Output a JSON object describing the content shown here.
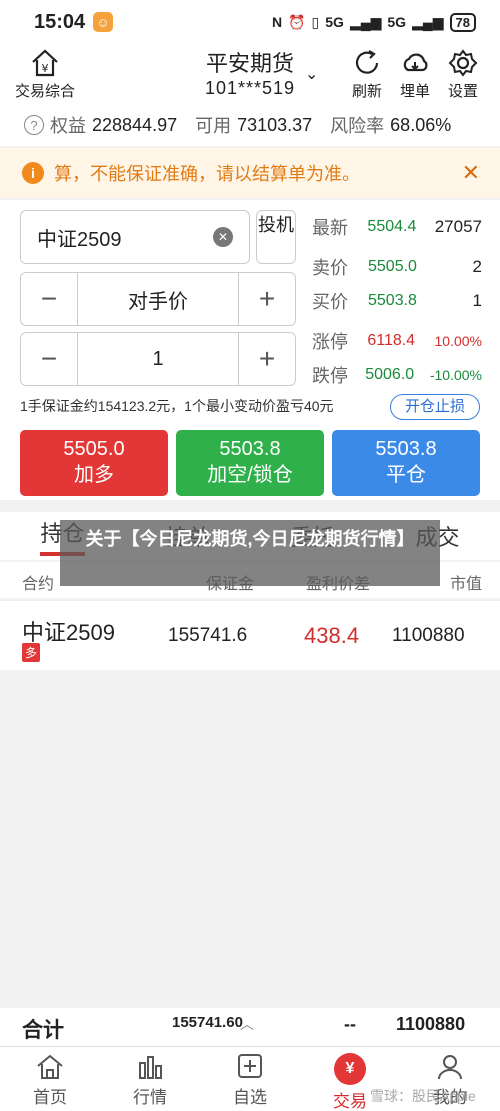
{
  "status": {
    "time": "15:04",
    "signal1": "5G",
    "signal2": "5G",
    "battery": "78"
  },
  "topbar": {
    "trade_label": "交易综合",
    "broker": "平安期货",
    "account": "101***519",
    "refresh": "刷新",
    "cloud": "埋单",
    "settings": "设置"
  },
  "funds": {
    "equity_label": "权益",
    "equity": "228844.97",
    "available_label": "可用",
    "available": "73103.37",
    "risk_label": "风险率",
    "risk": "68.06%"
  },
  "notice": {
    "text": "算，不能保证准确，请以结算单为准。"
  },
  "order": {
    "contract": "中证2509",
    "invest_label": "投机",
    "price_label": "对手价",
    "qty": "1",
    "margin_text": "1手保证金约154123.2元，1个最小变动价盈亏40元",
    "stop_btn": "开仓止损"
  },
  "quotes": [
    {
      "label": "最新",
      "price": "5504.4",
      "vol": "27057",
      "color": "green"
    },
    {
      "label": "卖价",
      "price": "5505.0",
      "vol": "2",
      "color": "green"
    },
    {
      "label": "买价",
      "price": "5503.8",
      "vol": "1",
      "color": "green"
    },
    {
      "label": "涨停",
      "price": "6118.4",
      "vol": "10.00%",
      "color": "red"
    },
    {
      "label": "跌停",
      "price": "5006.0",
      "vol": "-10.00%",
      "color": "green"
    }
  ],
  "buttons": {
    "buy_price": "5505.0",
    "buy_label": "加多",
    "sell_price": "5503.8",
    "sell_label": "加空/锁仓",
    "close_price": "5503.8",
    "close_label": "平仓"
  },
  "tabs": [
    "持仓",
    "挂单",
    "委托",
    "成交"
  ],
  "overlay_text": "关于【今日尼龙期货,今日尼龙期货行情】",
  "table": {
    "headers": [
      "合约",
      "保证金",
      "盈利价差",
      "市值"
    ],
    "rows": [
      {
        "name": "中证2509",
        "side": "多",
        "margin": "155741.6",
        "pnl": "438.4",
        "market_value": "1100880"
      }
    ]
  },
  "total": {
    "label": "合计",
    "margin": "155741.60",
    "pnl": "--",
    "market_value": "1100880"
  },
  "nav": [
    "首页",
    "行情",
    "自选",
    "交易",
    "我的"
  ],
  "nav_active_glyph": "¥",
  "watermark": "雪球：股民Apple"
}
